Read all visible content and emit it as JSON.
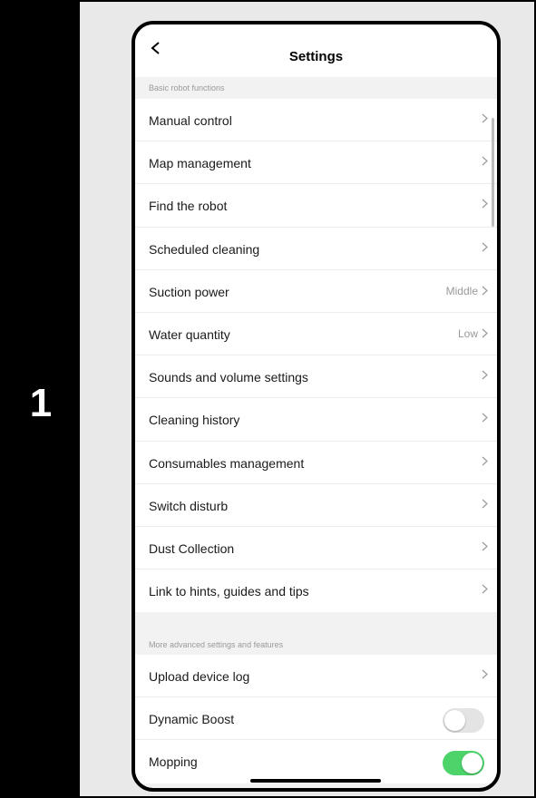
{
  "step": {
    "number": "1"
  },
  "nav": {
    "title": "Settings",
    "back_icon": "chevron-left-icon"
  },
  "sections": [
    {
      "header": "Basic robot functions",
      "items": [
        {
          "label": "Manual control",
          "value": ""
        },
        {
          "label": "Map management",
          "value": ""
        },
        {
          "label": "Find the robot",
          "value": ""
        },
        {
          "label": "Scheduled cleaning",
          "value": ""
        },
        {
          "label": "Suction power",
          "value": "Middle"
        },
        {
          "label": "Water quantity",
          "value": "Low"
        },
        {
          "label": "Sounds and volume settings",
          "value": ""
        },
        {
          "label": "Cleaning history",
          "value": ""
        },
        {
          "label": "Consumables management",
          "value": ""
        },
        {
          "label": "Switch disturb",
          "value": ""
        },
        {
          "label": "Dust Collection",
          "value": ""
        },
        {
          "label": "Link to hints, guides and tips",
          "value": ""
        }
      ]
    },
    {
      "header": "More advanced settings and features",
      "items": [
        {
          "label": "Upload device log",
          "type": "link"
        },
        {
          "label": "Dynamic Boost",
          "type": "toggle",
          "on": false
        },
        {
          "label": "Mopping",
          "type": "toggle",
          "on": true
        }
      ]
    }
  ],
  "colors": {
    "toggle_on": "#4cd36a",
    "toggle_off": "#e4e4e4",
    "step_background": "#000000"
  }
}
